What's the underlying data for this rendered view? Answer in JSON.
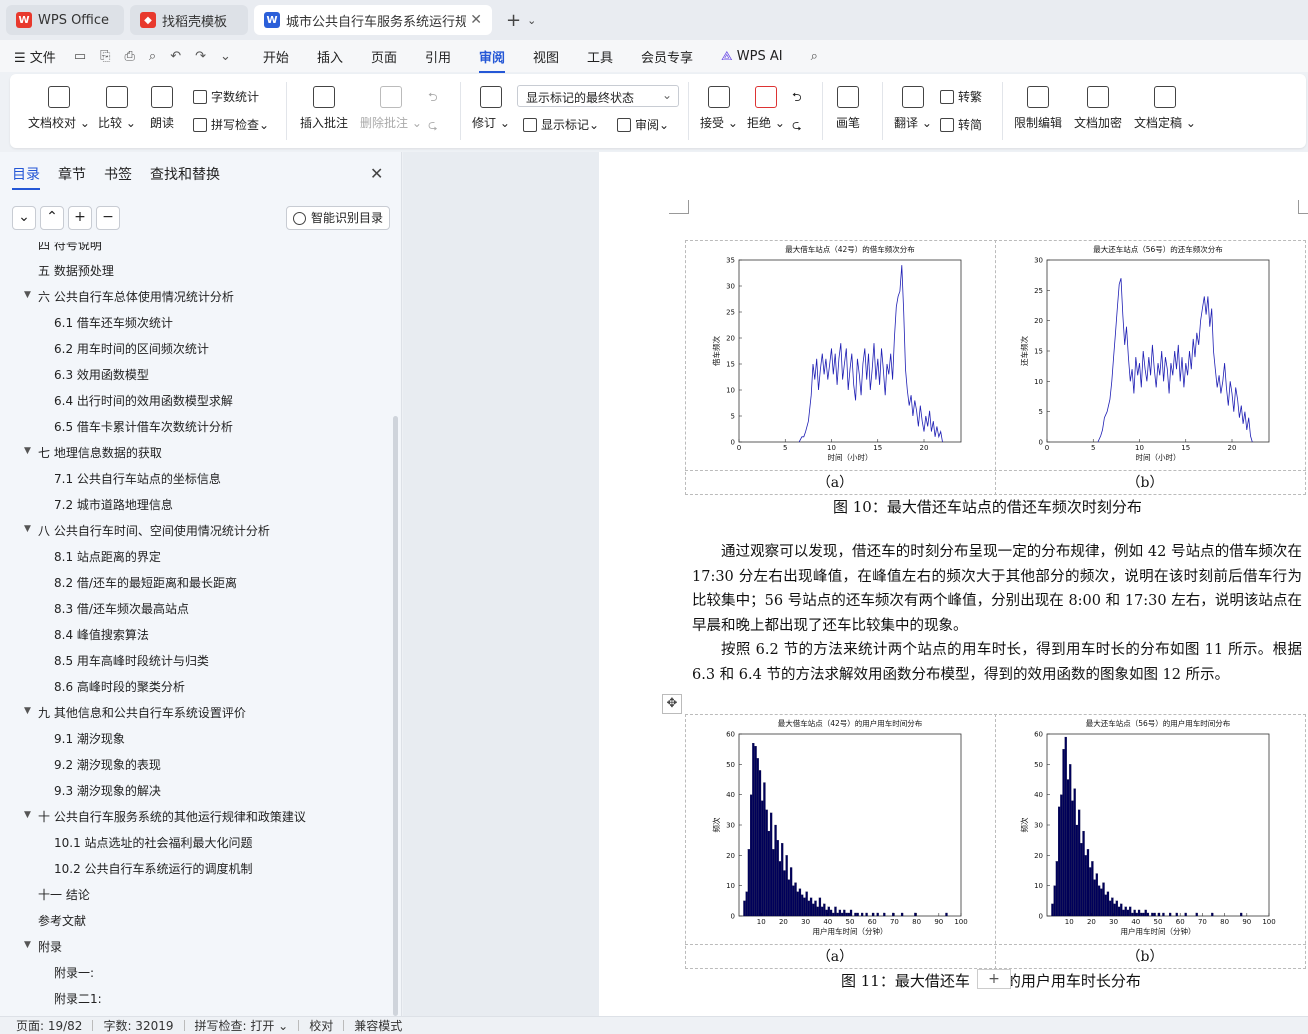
{
  "tabs": [
    {
      "label": "WPS Office",
      "icon": "wps-logo-icon",
      "color": "#e8392d"
    },
    {
      "label": "找稻壳模板",
      "icon": "docer-logo-icon",
      "color": "#e8392d"
    },
    {
      "label": "城市公共自行车服务系统运行规律",
      "icon": "word-doc-icon",
      "color": "#2b5fd9"
    }
  ],
  "menubar": {
    "file": "文件",
    "items": [
      "开始",
      "插入",
      "页面",
      "引用",
      "审阅",
      "视图",
      "工具",
      "会员专享"
    ],
    "active": "审阅",
    "ai": "WPS AI"
  },
  "ribbon": {
    "doc_check": "文档校对",
    "compare": "比较",
    "read_aloud": "朗读",
    "word_count": "字数统计",
    "spell_check": "拼写检查",
    "insert_comment": "插入批注",
    "delete_comment": "删除批注",
    "revise": "修订",
    "markup_combo": "显示标记的最终状态",
    "show_markup": "显示标记",
    "review": "审阅",
    "accept": "接受",
    "reject": "拒绝",
    "ink": "画笔",
    "translate": "翻译",
    "to_traditional": "转繁",
    "to_simplified": "转简",
    "restrict_edit": "限制编辑",
    "encrypt": "文档加密",
    "finalize": "文档定稿"
  },
  "nav": {
    "tabs": [
      "目录",
      "章节",
      "书签",
      "查找和替换"
    ],
    "smart_toc": "智能识别目录",
    "toc": [
      {
        "text": "四  符号说明",
        "level": 1,
        "arrow": false
      },
      {
        "text": "五  数据预处理",
        "level": 1,
        "arrow": false
      },
      {
        "text": "六  公共自行车总体使用情况统计分析",
        "level": 1,
        "arrow": true
      },
      {
        "text": "6.1 借车还车频次统计",
        "level": 2,
        "arrow": false
      },
      {
        "text": "6.2 用车时间的区间频次统计",
        "level": 2,
        "arrow": false
      },
      {
        "text": "6.3 效用函数模型",
        "level": 2,
        "arrow": false
      },
      {
        "text": "6.4 出行时间的效用函数模型求解",
        "level": 2,
        "arrow": false
      },
      {
        "text": "6.5  借车卡累计借车次数统计分析",
        "level": 2,
        "arrow": false
      },
      {
        "text": "七  地理信息数据的获取",
        "level": 1,
        "arrow": true
      },
      {
        "text": "7.1 公共自行车站点的坐标信息",
        "level": 2,
        "arrow": false
      },
      {
        "text": "7.2  城市道路地理信息",
        "level": 2,
        "arrow": false
      },
      {
        "text": "八  公共自行车时间、空间使用情况统计分析",
        "level": 1,
        "arrow": true
      },
      {
        "text": "8.1  站点距离的界定",
        "level": 2,
        "arrow": false
      },
      {
        "text": "8.2  借/还车的最短距离和最长距离",
        "level": 2,
        "arrow": false
      },
      {
        "text": "8.3  借/还车频次最高站点",
        "level": 2,
        "arrow": false
      },
      {
        "text": "8.4  峰值搜索算法",
        "level": 2,
        "arrow": false
      },
      {
        "text": "8.5 用车高峰时段统计与归类",
        "level": 2,
        "arrow": false
      },
      {
        "text": "8.6  高峰时段的聚类分析",
        "level": 2,
        "arrow": false
      },
      {
        "text": "九  其他信息和公共自行车系统设置评价",
        "level": 1,
        "arrow": true
      },
      {
        "text": "9.1  潮汐现象",
        "level": 2,
        "arrow": false
      },
      {
        "text": "9.2  潮汐现象的表现",
        "level": 2,
        "arrow": false
      },
      {
        "text": "9.3  潮汐现象的解决",
        "level": 2,
        "arrow": false
      },
      {
        "text": "十  公共自行车服务系统的其他运行规律和政策建议",
        "level": 1,
        "arrow": true
      },
      {
        "text": "10.1  站点选址的社会福利最大化问题",
        "level": 2,
        "arrow": false
      },
      {
        "text": "10.2  公共自行车系统运行的调度机制",
        "level": 2,
        "arrow": false
      },
      {
        "text": "十一  结论",
        "level": 1,
        "arrow": false
      },
      {
        "text": "参考文献",
        "level": 1,
        "arrow": false
      },
      {
        "text": "附录",
        "level": 1,
        "arrow": true
      },
      {
        "text": "附录一:",
        "level": 2,
        "arrow": false
      },
      {
        "text": "附录二1:",
        "level": 2,
        "arrow": false
      }
    ]
  },
  "doc": {
    "fig10_label_a": "（a）",
    "fig10_label_b": "（b）",
    "fig10_caption": "图 10：最大借还车站点的借还车频次时刻分布",
    "para1": "通过观察可以发现，借还车的时刻分布呈现一定的分布规律，例如 42 号站点的借车频次在 17:30 分左右出现峰值，在峰值左右的频次大于其他部分的频次，说明在该时刻前后借车行为比较集中；56 号站点的还车频次有两个峰值，分别出现在 8:00 和 17:30 左右，说明该站点在早晨和晚上都出现了还车比较集中的现象。",
    "para2": "按照 6.2 节的方法来统计两个站点的用车时长，得到用车时长的分布如图 11 所示。根据 6.3 和 6.4 节的方法求解效用函数分布模型，得到的效用函数的图象如图 12 所示。",
    "fig11_label_a": "（a）",
    "fig11_label_b": "（b）",
    "fig11_caption_left": "图 11：最大借还车",
    "fig11_caption_right": "的用户用车时长分布"
  },
  "chart_data": [
    {
      "type": "line",
      "title": "最大借车站点（42号）的借车频次分布",
      "xlabel": "时间（小时）",
      "ylabel": "借车频次",
      "xlim": [
        0,
        24
      ],
      "ylim": [
        0,
        35
      ],
      "xticks": [
        0,
        5,
        10,
        15,
        20
      ],
      "yticks": [
        0,
        5,
        10,
        15,
        20,
        25,
        30,
        35
      ],
      "color": "#1f1fb4",
      "x": [
        6.5,
        6.8,
        7.0,
        7.2,
        7.5,
        7.8,
        8.0,
        8.2,
        8.4,
        8.6,
        8.8,
        9.0,
        9.2,
        9.4,
        9.6,
        9.8,
        10.0,
        10.2,
        10.4,
        10.6,
        10.8,
        11.0,
        11.2,
        11.4,
        11.6,
        11.8,
        12.0,
        12.2,
        12.4,
        12.6,
        12.8,
        13.0,
        13.2,
        13.4,
        13.6,
        13.8,
        14.0,
        14.2,
        14.4,
        14.6,
        14.8,
        15.0,
        15.2,
        15.4,
        15.6,
        15.8,
        16.0,
        16.2,
        16.4,
        16.6,
        16.8,
        17.0,
        17.2,
        17.4,
        17.6,
        17.8,
        18.0,
        18.2,
        18.4,
        18.6,
        18.8,
        19.0,
        19.2,
        19.4,
        19.6,
        19.8,
        20.0,
        20.2,
        20.4,
        20.6,
        20.8,
        21.0,
        21.2,
        21.4,
        21.6,
        21.8,
        22.0
      ],
      "y": [
        0,
        1,
        1,
        2,
        4,
        9,
        15,
        12,
        16,
        10,
        14,
        17,
        13,
        16,
        12,
        15,
        18,
        13,
        17,
        11,
        16,
        19,
        12,
        15,
        18,
        10,
        14,
        17,
        11,
        8,
        16,
        13,
        9,
        15,
        18,
        12,
        17,
        10,
        14,
        19,
        12,
        16,
        11,
        18,
        14,
        9,
        15,
        13,
        17,
        12,
        20,
        26,
        28,
        29,
        34,
        25,
        14,
        10,
        7,
        9,
        5,
        8,
        6,
        3,
        7,
        4,
        2,
        5,
        3,
        6,
        2,
        4,
        1,
        3,
        1,
        2,
        0
      ]
    },
    {
      "type": "line",
      "title": "最大还车站点（56号）的还车频次分布",
      "xlabel": "时间（小时）",
      "ylabel": "还车频次",
      "xlim": [
        0,
        24
      ],
      "ylim": [
        0,
        30
      ],
      "xticks": [
        0,
        5,
        10,
        15,
        20
      ],
      "yticks": [
        0,
        5,
        10,
        15,
        20,
        25,
        30
      ],
      "color": "#1f1fb4",
      "x": [
        5.5,
        5.8,
        6.0,
        6.2,
        6.5,
        6.8,
        7.0,
        7.2,
        7.4,
        7.6,
        7.8,
        8.0,
        8.2,
        8.4,
        8.6,
        8.8,
        9.0,
        9.2,
        9.4,
        9.6,
        9.8,
        10.0,
        10.2,
        10.4,
        10.6,
        10.8,
        11.0,
        11.2,
        11.4,
        11.6,
        11.8,
        12.0,
        12.2,
        12.4,
        12.6,
        12.8,
        13.0,
        13.2,
        13.4,
        13.6,
        13.8,
        14.0,
        14.2,
        14.4,
        14.6,
        14.8,
        15.0,
        15.2,
        15.4,
        15.6,
        15.8,
        16.0,
        16.2,
        16.4,
        16.6,
        16.8,
        17.0,
        17.2,
        17.4,
        17.6,
        17.8,
        18.0,
        18.2,
        18.4,
        18.6,
        18.8,
        19.0,
        19.2,
        19.4,
        19.6,
        19.8,
        20.0,
        20.2,
        20.4,
        20.6,
        20.8,
        21.0,
        21.2,
        21.4,
        21.6,
        21.8,
        22.0,
        22.2
      ],
      "y": [
        0,
        1,
        2,
        4,
        5,
        7,
        10,
        14,
        18,
        22,
        26,
        27,
        21,
        16,
        19,
        14,
        10,
        12,
        8,
        14,
        11,
        13,
        9,
        15,
        12,
        10,
        14,
        11,
        16,
        12,
        9,
        13,
        11,
        15,
        10,
        14,
        12,
        8,
        13,
        11,
        15,
        12,
        16,
        10,
        14,
        9,
        13,
        11,
        15,
        12,
        17,
        14,
        18,
        16,
        20,
        22,
        24,
        21,
        24,
        19,
        22,
        15,
        12,
        9,
        11,
        8,
        10,
        13,
        9,
        6,
        10,
        8,
        5,
        9,
        7,
        4,
        6,
        3,
        5,
        2,
        4,
        1,
        0
      ]
    },
    {
      "type": "bar",
      "title": "最大借车站点（42号）的用户用车时间分布",
      "xlabel": "用户用车时间（分钟）",
      "ylabel": "频次",
      "xlim": [
        0,
        100
      ],
      "ylim": [
        0,
        60
      ],
      "xticks": [
        10,
        20,
        30,
        40,
        50,
        60,
        70,
        80,
        90,
        100
      ],
      "yticks": [
        0,
        10,
        20,
        30,
        40,
        50,
        60
      ],
      "color": "#00005a",
      "bins": [
        1,
        2,
        3,
        4,
        5,
        6,
        7,
        8,
        9,
        10,
        11,
        12,
        13,
        14,
        15,
        16,
        17,
        18,
        19,
        20,
        21,
        22,
        23,
        24,
        25,
        26,
        27,
        28,
        29,
        30,
        31,
        32,
        33,
        34,
        35,
        36,
        37,
        38,
        39,
        40,
        41,
        42,
        43,
        44,
        45,
        46,
        47,
        48,
        49,
        50,
        51,
        52,
        53,
        54,
        55,
        56,
        57,
        58,
        59,
        60,
        61,
        62,
        63,
        64,
        65,
        66,
        67,
        68,
        69,
        70,
        71,
        72,
        73,
        74,
        75,
        76,
        77,
        78,
        79,
        80,
        81,
        82,
        83,
        84,
        85,
        86,
        87,
        88,
        89,
        90,
        91,
        92,
        93,
        94,
        95,
        96,
        97,
        98,
        99,
        100
      ],
      "values": [
        0,
        0,
        5,
        8,
        22,
        40,
        57,
        56,
        52,
        48,
        38,
        44,
        35,
        28,
        34,
        22,
        30,
        25,
        18,
        24,
        15,
        20,
        12,
        16,
        10,
        11,
        8,
        9,
        7,
        6,
        8,
        5,
        6,
        4,
        5,
        3,
        6,
        3,
        4,
        2,
        3,
        2,
        1,
        3,
        1,
        2,
        1,
        2,
        1,
        1,
        2,
        0,
        1,
        1,
        0,
        1,
        0,
        1,
        0,
        0,
        1,
        0,
        1,
        0,
        0,
        1,
        0,
        0,
        0,
        1,
        0,
        0,
        0,
        1,
        0,
        0,
        0,
        0,
        0,
        1,
        0,
        0,
        0,
        0,
        0,
        0,
        0,
        0,
        0,
        0,
        0,
        0,
        0,
        1,
        0,
        0,
        0,
        0,
        0,
        0
      ]
    },
    {
      "type": "bar",
      "title": "最大还车站点（56号）的用户用车时间分布",
      "xlabel": "用户用车时间（分钟）",
      "ylabel": "频次",
      "xlim": [
        0,
        100
      ],
      "ylim": [
        0,
        60
      ],
      "xticks": [
        10,
        20,
        30,
        40,
        50,
        60,
        70,
        80,
        90,
        100
      ],
      "yticks": [
        0,
        10,
        20,
        30,
        40,
        50,
        60
      ],
      "color": "#00005a",
      "bins": [
        1,
        2,
        3,
        4,
        5,
        6,
        7,
        8,
        9,
        10,
        11,
        12,
        13,
        14,
        15,
        16,
        17,
        18,
        19,
        20,
        21,
        22,
        23,
        24,
        25,
        26,
        27,
        28,
        29,
        30,
        31,
        32,
        33,
        34,
        35,
        36,
        37,
        38,
        39,
        40,
        41,
        42,
        43,
        44,
        45,
        46,
        47,
        48,
        49,
        50,
        51,
        52,
        53,
        54,
        55,
        56,
        57,
        58,
        59,
        60,
        61,
        62,
        63,
        64,
        65,
        66,
        67,
        68,
        69,
        70,
        71,
        72,
        73,
        74,
        75,
        76,
        77,
        78,
        79,
        80,
        81,
        82,
        83,
        84,
        85,
        86,
        87,
        88,
        89,
        90,
        91,
        92,
        93,
        94,
        95,
        96,
        97,
        98,
        99,
        100
      ],
      "values": [
        0,
        0,
        4,
        10,
        18,
        36,
        40,
        55,
        59,
        45,
        50,
        38,
        42,
        30,
        35,
        24,
        28,
        20,
        22,
        16,
        18,
        12,
        14,
        10,
        9,
        11,
        7,
        8,
        5,
        6,
        4,
        5,
        3,
        4,
        2,
        3,
        2,
        3,
        1,
        2,
        1,
        2,
        1,
        1,
        2,
        1,
        0,
        1,
        1,
        0,
        1,
        0,
        1,
        0,
        0,
        1,
        0,
        0,
        1,
        0,
        0,
        0,
        1,
        0,
        0,
        0,
        0,
        1,
        0,
        0,
        0,
        0,
        0,
        0,
        1,
        0,
        0,
        0,
        0,
        0,
        0,
        0,
        0,
        0,
        0,
        0,
        0,
        1,
        0,
        0,
        0,
        0,
        0,
        0,
        0,
        0,
        0,
        0,
        0,
        0
      ]
    }
  ],
  "status": {
    "page": "页面: 19/82",
    "words": "字数: 32019",
    "spell": "拼写检查: 打开",
    "proof": "校对",
    "compat": "兼容模式"
  }
}
